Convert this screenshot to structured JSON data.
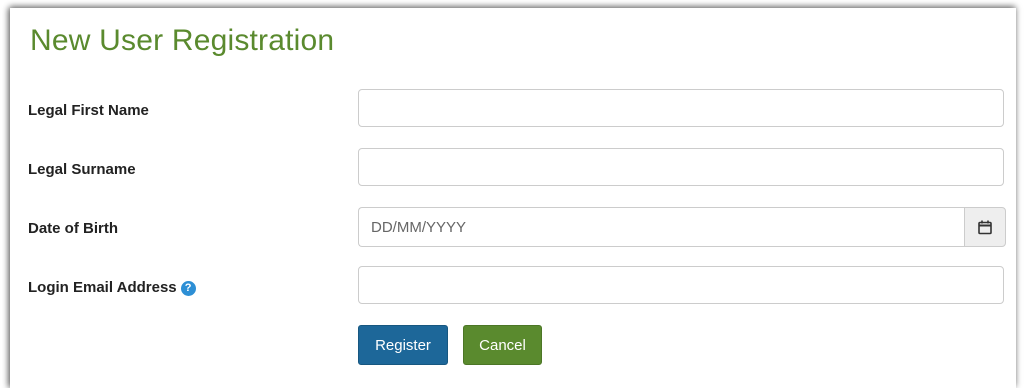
{
  "form": {
    "title": "New User Registration",
    "fields": {
      "first_name": {
        "label": "Legal First Name",
        "value": "",
        "placeholder": ""
      },
      "surname": {
        "label": "Legal Surname",
        "value": "",
        "placeholder": ""
      },
      "dob": {
        "label": "Date of Birth",
        "value": "",
        "placeholder": "DD/MM/YYYY"
      },
      "email": {
        "label": "Login Email Address",
        "value": "",
        "placeholder": ""
      }
    },
    "help_icon_glyph": "?",
    "buttons": {
      "register": "Register",
      "cancel": "Cancel"
    }
  },
  "icons": {
    "help": "question-circle-icon",
    "calendar": "calendar-icon"
  },
  "colors": {
    "title": "#5a8a2e",
    "register_button": "#1d6799",
    "cancel_button": "#5a8a2e",
    "help_icon": "#2d8fd5"
  }
}
